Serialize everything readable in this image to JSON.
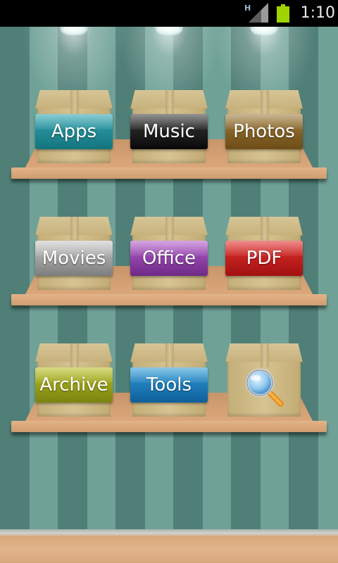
{
  "status_bar": {
    "network_type": "H",
    "time": "1:10",
    "icons": [
      "signal-icon",
      "battery-icon"
    ],
    "battery_color": "#9fd400"
  },
  "shelves": [
    {
      "boxes": [
        {
          "label": "Apps",
          "color": "#14747e"
        },
        {
          "label": "Music",
          "color": "#080808"
        },
        {
          "label": "Photos",
          "color": "#6d4c17"
        }
      ]
    },
    {
      "boxes": [
        {
          "label": "Movies",
          "color": "#7d7d7d"
        },
        {
          "label": "Office",
          "color": "#6e2a86"
        },
        {
          "label": "PDF",
          "color": "#a11110"
        }
      ]
    },
    {
      "boxes": [
        {
          "label": "Archive",
          "color": "#7b8311"
        },
        {
          "label": "Tools",
          "color": "#0f5f9a"
        },
        {
          "label": "",
          "icon": "search-icon"
        }
      ]
    }
  ],
  "theme": {
    "wall_stripe_dark": "#4f7f77",
    "wall_stripe_light": "#6fa197",
    "shelf_wood": "#dba77a",
    "box_cardboard": "#d6c392"
  }
}
